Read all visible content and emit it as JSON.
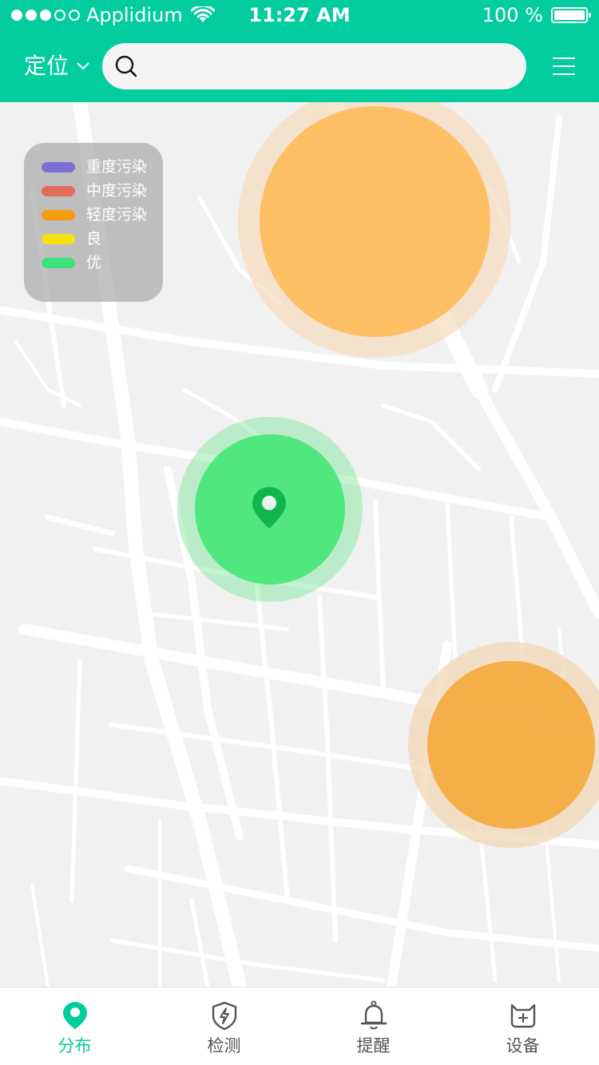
{
  "status_bar": {
    "carrier": "Applidium",
    "time": "11:27 AM",
    "battery": "100 %",
    "battery_level_pct": 100
  },
  "header": {
    "locate_label": "定位",
    "search_placeholder": "",
    "search_icon": "search-icon",
    "menu_icon": "menu-icon",
    "color": "#03cc9e"
  },
  "legend": [
    {
      "label": "重度污染",
      "color": "#7b6fd6"
    },
    {
      "label": "中度污染",
      "color": "#e06c5a"
    },
    {
      "label": "轻度污染",
      "color": "#f39c12"
    },
    {
      "label": "良",
      "color": "#f6e012"
    },
    {
      "label": "优",
      "color": "#3ee27a"
    }
  ],
  "map": {
    "zones": [
      {
        "level": "轻度污染"
      },
      {
        "level": "优"
      },
      {
        "level": "轻度污染"
      }
    ],
    "pin_icon": "location-pin-icon"
  },
  "tabs": [
    {
      "label": "分布",
      "icon": "map-pin-icon",
      "active": true
    },
    {
      "label": "检测",
      "icon": "shield-bolt-icon",
      "active": false
    },
    {
      "label": "提醒",
      "icon": "bell-icon",
      "active": false
    },
    {
      "label": "设备",
      "icon": "device-icon",
      "active": false
    }
  ],
  "colors": {
    "accent": "#03cc9e",
    "inactive_tab": "#555555"
  }
}
